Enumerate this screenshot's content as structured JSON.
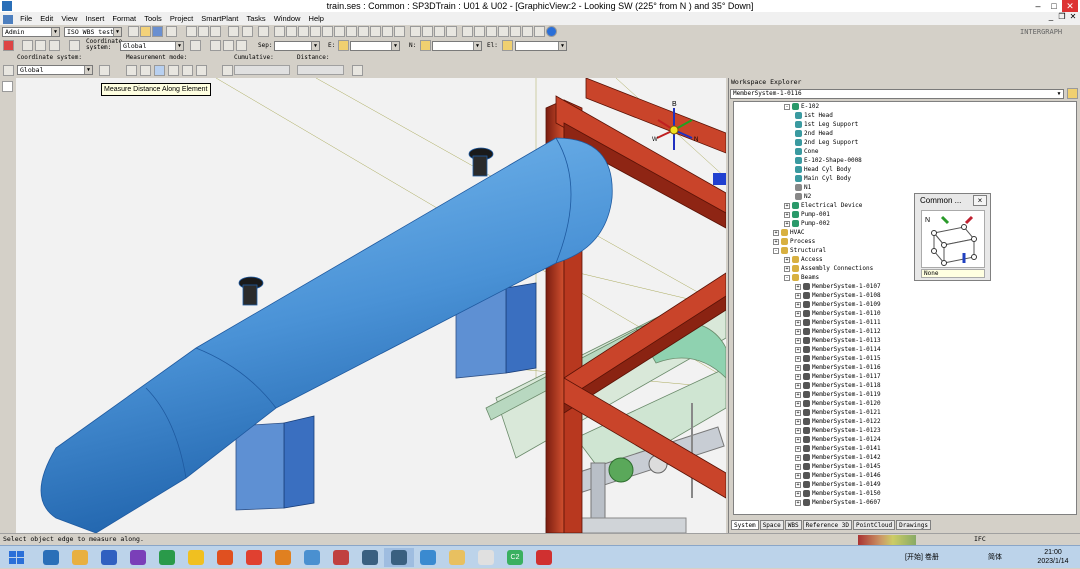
{
  "window": {
    "title": "train.ses : Common : SP3DTrain : U01 & U02 - [GraphicView:2 - Looking SW (225° from N ) and 35° Down]"
  },
  "menu": [
    "File",
    "Edit",
    "View",
    "Insert",
    "Format",
    "Tools",
    "Project",
    "SmartPlant",
    "Tasks",
    "Window",
    "Help"
  ],
  "toolbar1": {
    "user": "Admin",
    "filter": "ISO WBS test",
    "coord_label": "Coordinate system:",
    "coord_value": "Global",
    "sep_label": "Sep:",
    "e_label": "E:",
    "n_label": "N:",
    "el_label": "El:",
    "brand": "INTERGRAPH"
  },
  "toolbar2": {
    "coord_label": "Coordinate system:",
    "coord_value": "Global",
    "mode_label": "Measurement mode:",
    "cumulative_label": "Cumulative:",
    "distance_label": "Distance:"
  },
  "tooltip": "Measure Distance Along Element",
  "explorer": {
    "title": "Workspace Explorer",
    "selected": "MemberSystem-1-0116",
    "tree": [
      {
        "label": "E-102",
        "level": 2,
        "icon": "equipment-icon",
        "exp": "-"
      },
      {
        "label": "1st Head",
        "level": 3,
        "icon": "shape-icon"
      },
      {
        "label": "1st Leg Support",
        "level": 3,
        "icon": "shape-icon"
      },
      {
        "label": "2nd Head",
        "level": 3,
        "icon": "shape-icon"
      },
      {
        "label": "2nd Leg Support",
        "level": 3,
        "icon": "shape-icon"
      },
      {
        "label": "Cone",
        "level": 3,
        "icon": "shape-icon"
      },
      {
        "label": "E-102-Shape-0008",
        "level": 3,
        "icon": "shape-icon"
      },
      {
        "label": "Head Cyl Body",
        "level": 3,
        "icon": "shape-icon"
      },
      {
        "label": "Main Cyl Body",
        "level": 3,
        "icon": "shape-icon"
      },
      {
        "label": "N1",
        "level": 3,
        "icon": "nozzle-icon"
      },
      {
        "label": "N2",
        "level": 3,
        "icon": "nozzle-icon"
      },
      {
        "label": "Electrical Device",
        "level": 2,
        "icon": "equipment-icon",
        "exp": "+"
      },
      {
        "label": "Pump-001",
        "level": 2,
        "icon": "equipment-icon",
        "exp": "+"
      },
      {
        "label": "Pump-002",
        "level": 2,
        "icon": "equipment-icon",
        "exp": "+"
      },
      {
        "label": "HVAC",
        "level": 1,
        "icon": "system-icon",
        "exp": "+"
      },
      {
        "label": "Process",
        "level": 1,
        "icon": "system-icon",
        "exp": "+"
      },
      {
        "label": "Structural",
        "level": 1,
        "icon": "system-icon",
        "exp": "-"
      },
      {
        "label": "Access",
        "level": 2,
        "icon": "system-icon",
        "exp": "+"
      },
      {
        "label": "Assembly Connections",
        "level": 2,
        "icon": "system-icon",
        "exp": "+"
      },
      {
        "label": "Beams",
        "level": 2,
        "icon": "system-icon",
        "exp": "-"
      },
      {
        "label": "MemberSystem-1-0107",
        "level": 3,
        "icon": "member-icon",
        "exp": "+"
      },
      {
        "label": "MemberSystem-1-0108",
        "level": 3,
        "icon": "member-icon",
        "exp": "+"
      },
      {
        "label": "MemberSystem-1-0109",
        "level": 3,
        "icon": "member-icon",
        "exp": "+"
      },
      {
        "label": "MemberSystem-1-0110",
        "level": 3,
        "icon": "member-icon",
        "exp": "+"
      },
      {
        "label": "MemberSystem-1-0111",
        "level": 3,
        "icon": "member-icon",
        "exp": "+"
      },
      {
        "label": "MemberSystem-1-0112",
        "level": 3,
        "icon": "member-icon",
        "exp": "+"
      },
      {
        "label": "MemberSystem-1-0113",
        "level": 3,
        "icon": "member-icon",
        "exp": "+"
      },
      {
        "label": "MemberSystem-1-0114",
        "level": 3,
        "icon": "member-icon",
        "exp": "+"
      },
      {
        "label": "MemberSystem-1-0115",
        "level": 3,
        "icon": "member-icon",
        "exp": "+"
      },
      {
        "label": "MemberSystem-1-0116",
        "level": 3,
        "icon": "member-icon",
        "exp": "+"
      },
      {
        "label": "MemberSystem-1-0117",
        "level": 3,
        "icon": "member-icon",
        "exp": "+"
      },
      {
        "label": "MemberSystem-1-0118",
        "level": 3,
        "icon": "member-icon",
        "exp": "+"
      },
      {
        "label": "MemberSystem-1-0119",
        "level": 3,
        "icon": "member-icon",
        "exp": "+"
      },
      {
        "label": "MemberSystem-1-0120",
        "level": 3,
        "icon": "member-icon",
        "exp": "+"
      },
      {
        "label": "MemberSystem-1-0121",
        "level": 3,
        "icon": "member-icon",
        "exp": "+"
      },
      {
        "label": "MemberSystem-1-0122",
        "level": 3,
        "icon": "member-icon",
        "exp": "+"
      },
      {
        "label": "MemberSystem-1-0123",
        "level": 3,
        "icon": "member-icon",
        "exp": "+"
      },
      {
        "label": "MemberSystem-1-0124",
        "level": 3,
        "icon": "member-icon",
        "exp": "+"
      },
      {
        "label": "MemberSystem-1-0141",
        "level": 3,
        "icon": "member-icon",
        "exp": "+"
      },
      {
        "label": "MemberSystem-1-0142",
        "level": 3,
        "icon": "member-icon",
        "exp": "+"
      },
      {
        "label": "MemberSystem-1-0145",
        "level": 3,
        "icon": "member-icon",
        "exp": "+"
      },
      {
        "label": "MemberSystem-1-0146",
        "level": 3,
        "icon": "member-icon",
        "exp": "+"
      },
      {
        "label": "MemberSystem-1-0149",
        "level": 3,
        "icon": "member-icon",
        "exp": "+"
      },
      {
        "label": "MemberSystem-1-0150",
        "level": 3,
        "icon": "member-icon",
        "exp": "+"
      },
      {
        "label": "MemberSystem-1-0607",
        "level": 3,
        "icon": "member-icon",
        "exp": "+"
      }
    ],
    "tabs": [
      "System",
      "Space",
      "WBS",
      "Reference 3D",
      "PointCloud",
      "Drawings"
    ],
    "active_tab": "System"
  },
  "common_palette": {
    "title": "Common ...",
    "close": "×",
    "n_label": "N",
    "status": "None"
  },
  "status": {
    "message": "Select object edge to measure along.",
    "right_label": "IFC"
  },
  "compass": {
    "b": "B",
    "n": "N",
    "w": "W"
  },
  "taskbar": {
    "apps": [
      "explorer-icon",
      "file-manager-icon",
      "remote-desktop-icon",
      "visual-studio-icon",
      "sharepoint-icon",
      "yellow-app-icon",
      "office-icon",
      "chrome-icon",
      "search-magnifier-icon",
      "network-icon",
      "tools-icon",
      "smart3d-icon",
      "smart3d-active-icon",
      "airplane-icon",
      "folder-icon",
      "printer-icon",
      "c2-icon",
      "pdf-icon"
    ],
    "tray_text": "[开始] 卷册",
    "lang": "简体",
    "time": "21:00",
    "date": "2023/1/14",
    "c2_label": "C2"
  },
  "colors": {
    "vessel": "#5aa0e0",
    "steel": "#c8402a",
    "viewport_bg": "#f2f2f2",
    "tooltip": "#ffffe1"
  }
}
